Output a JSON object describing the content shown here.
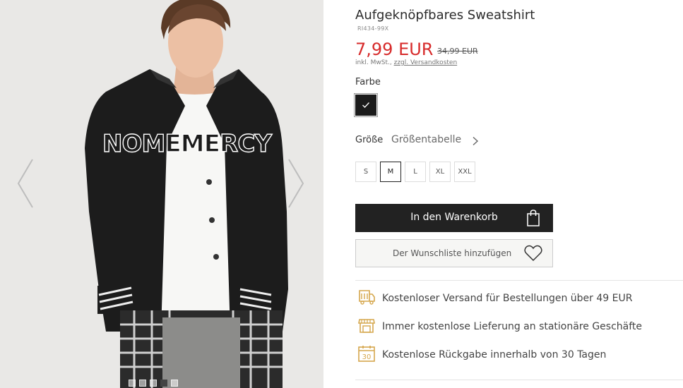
{
  "product": {
    "title": "Aufgeknöpfbares Sweatshirt",
    "sku": "RI434-99X",
    "price_new": "7,99 EUR",
    "price_old": "34,99 EUR",
    "tax_prefix": "inkl. MwSt., ",
    "shipping_link": "zzgl. Versandkosten",
    "jacket_print": "NOMEMERCY"
  },
  "color": {
    "label": "Farbe",
    "swatch_hex": "#1b1b1b",
    "selected_icon": "checkmark-icon"
  },
  "size": {
    "label": "Größe",
    "table_link": "Größentabelle",
    "options": [
      "S",
      "M",
      "L",
      "XL",
      "XXL"
    ],
    "selected": "M"
  },
  "actions": {
    "cart_label": "In den Warenkorb",
    "cart_icon": "shopping-bag-icon",
    "wishlist_label": "Der Wunschliste hinzufügen",
    "wishlist_icon": "heart-icon"
  },
  "gallery": {
    "prev_icon": "chevron-left-icon",
    "next_icon": "chevron-right-icon",
    "dot_count": 5,
    "active_dot": 3
  },
  "features": [
    {
      "icon": "truck-icon",
      "text": "Kostenloser Versand für Bestellungen über 49 EUR"
    },
    {
      "icon": "store-icon",
      "text": "Immer kostenlose Lieferung an stationäre Geschäfte"
    },
    {
      "icon": "calendar-30-icon",
      "text": "Kostenlose Rückgabe innerhalb von 30 Tagen",
      "badge": "30"
    }
  ],
  "colors": {
    "accent_gold": "#d5a74d",
    "price_red": "#d72b2b",
    "button_dark": "#222222"
  }
}
